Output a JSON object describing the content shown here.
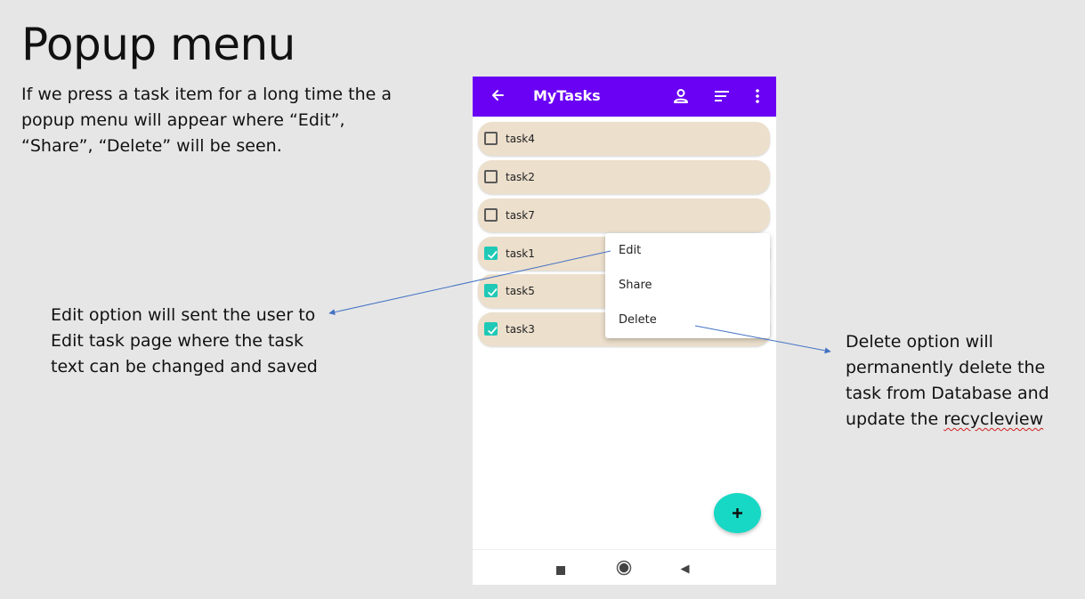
{
  "slide": {
    "title": "Popup menu",
    "intro": "If we press a task item for a long time the a popup menu will appear where “Edit”, “Share”, “Delete” will be seen.",
    "edit_note": "Edit option will sent the user to Edit task page where the task text can be changed and saved",
    "delete_note_before": "Delete option will permanently delete the task from Database and update the ",
    "delete_note_word": "recycleview"
  },
  "app": {
    "title": "MyTasks",
    "icons": {
      "back": "arrow-back-icon",
      "profile": "person-icon",
      "sort": "sort-icon",
      "more": "more-vert-icon",
      "add": "plus-icon"
    },
    "colors": {
      "app_bar": "#6a00f4",
      "task_item": "#ecdfcc",
      "accent": "#1fc9b6"
    }
  },
  "tasks": [
    {
      "label": "task4",
      "checked": false
    },
    {
      "label": "task2",
      "checked": false
    },
    {
      "label": "task7",
      "checked": false
    },
    {
      "label": "task1",
      "checked": true
    },
    {
      "label": "task5",
      "checked": true
    },
    {
      "label": "task3",
      "checked": true
    }
  ],
  "popup_menu": {
    "items": [
      "Edit",
      "Share",
      "Delete"
    ]
  },
  "nav_bar": {
    "icons": [
      "recents-square-icon",
      "home-circle-icon",
      "back-triangle-icon"
    ]
  }
}
